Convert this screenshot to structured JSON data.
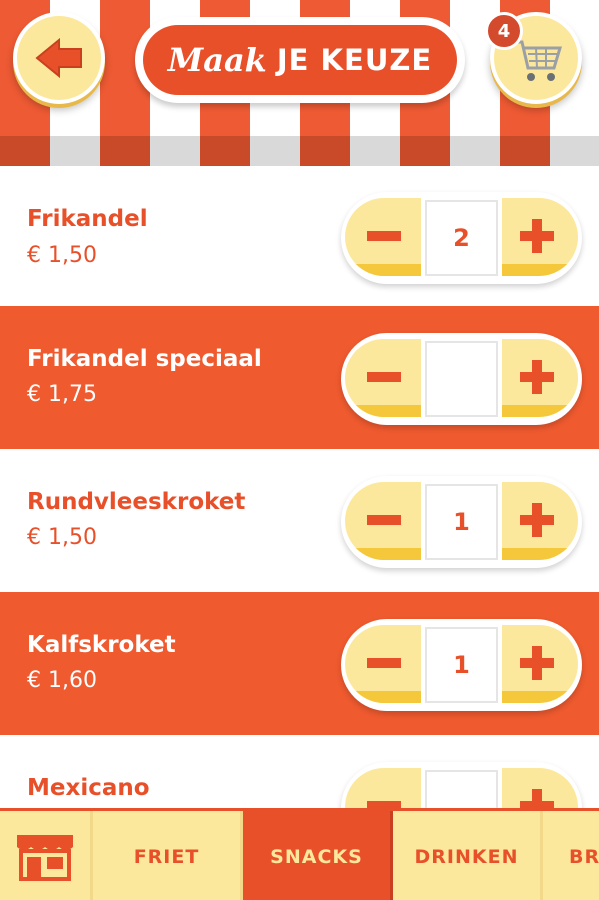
{
  "header": {
    "title_script": "Maak",
    "title_caps": "JE KEUZE",
    "cart_count": "4",
    "back_icon": "arrow-left-icon",
    "cart_icon": "shopping-cart-icon"
  },
  "products": [
    {
      "name": "Frikandel",
      "price": "€ 1,50",
      "quantity": "2"
    },
    {
      "name": "Frikandel speciaal",
      "price": "€ 1,75",
      "quantity": ""
    },
    {
      "name": "Rundvleeskroket",
      "price": "€ 1,50",
      "quantity": "1"
    },
    {
      "name": "Kalfskroket",
      "price": "€ 1,60",
      "quantity": "1"
    },
    {
      "name": "Mexicano",
      "price": "",
      "quantity": ""
    }
  ],
  "tabs": [
    {
      "label": "",
      "icon": "shop-icon"
    },
    {
      "label": "FRIET"
    },
    {
      "label": "SNACKS",
      "active": true
    },
    {
      "label": "DRINKEN"
    },
    {
      "label": "BR"
    }
  ],
  "colors": {
    "accent": "#e8502a",
    "row_orange": "#ef5a2f",
    "button_yellow": "#fce89c",
    "button_yellow_dark": "#f5c83c"
  }
}
